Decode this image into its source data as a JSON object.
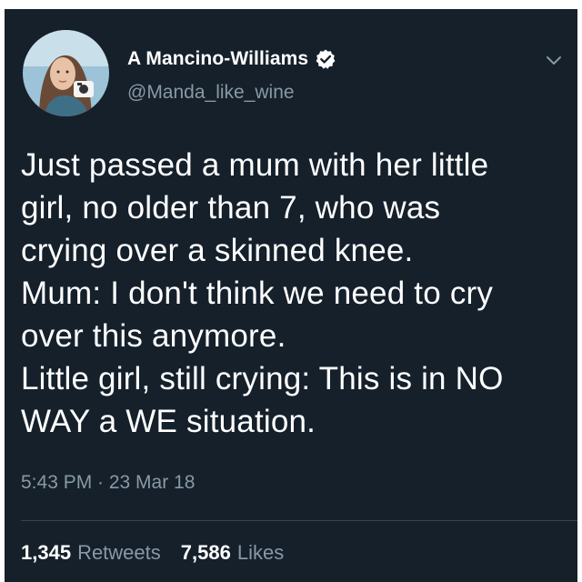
{
  "tweet": {
    "author": {
      "display_name": "A Mancino-Williams",
      "handle": "@Manda_like_wine",
      "verified": true
    },
    "body_lines": [
      "Just passed a mum with her little",
      "girl, no older than 7, who was",
      "crying over a skinned knee.",
      "Mum: I don't think we need to cry",
      "over this anymore.",
      "Little girl, still crying: This is in NO",
      "WAY a WE situation."
    ],
    "timestamp": "5:43 PM · 23 Mar 18",
    "stats": {
      "retweets_count": "1,345",
      "retweets_label": "Retweets",
      "likes_count": "7,586",
      "likes_label": "Likes"
    }
  },
  "icons": {
    "verified": "verified-badge-icon",
    "menu": "chevron-down-icon"
  },
  "colors": {
    "background": "#15202b",
    "text_primary": "#ffffff",
    "text_secondary": "#8899a6",
    "divider": "#38444d",
    "verified_badge": "#ffffff"
  }
}
